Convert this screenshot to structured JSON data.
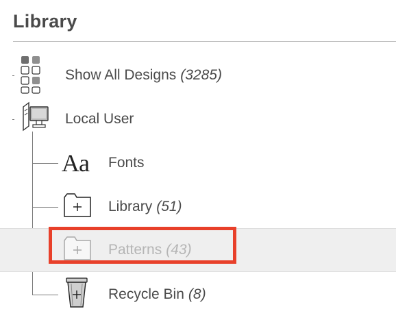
{
  "header": {
    "title": "Library"
  },
  "tree": {
    "items": [
      {
        "label": "Show All Designs",
        "count": "(3285)",
        "icon": "grid-icon"
      },
      {
        "label": "Local User",
        "count": "",
        "icon": "local-user-computer-icon"
      },
      {
        "label": "Fonts",
        "count": "",
        "icon": "fonts-icon",
        "glyph": "Aa"
      },
      {
        "label": "Library",
        "count": "(51)",
        "icon": "folder-plus-icon"
      },
      {
        "label": "Patterns",
        "count": "(43)",
        "icon": "folder-plus-icon",
        "selected": true
      },
      {
        "label": "Recycle Bin",
        "count": "(8)",
        "icon": "trash-can-icon"
      }
    ]
  },
  "colors": {
    "highlight": "#e8402a",
    "selected_row": "#efefef",
    "disabled_text": "#b5b5b5"
  }
}
